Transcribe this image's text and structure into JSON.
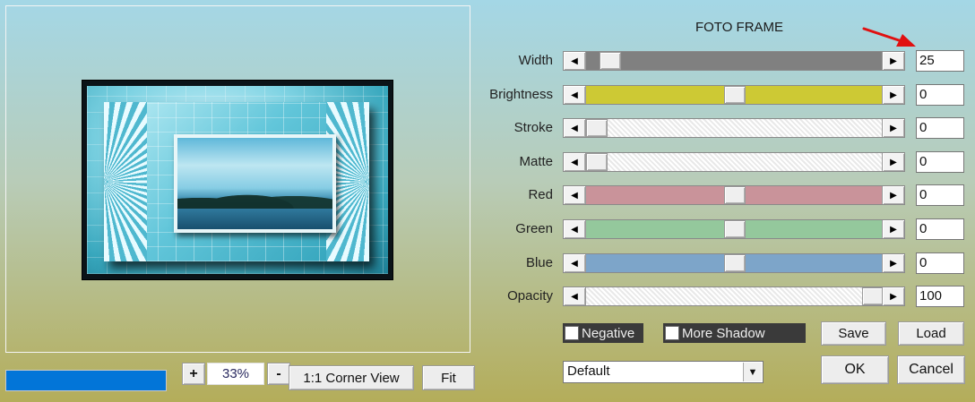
{
  "title": "FOTO FRAME",
  "sliders": [
    {
      "label": "Width",
      "value": "25",
      "position": 0.05,
      "fill": "#808080",
      "track_style": "solid"
    },
    {
      "label": "Brightness",
      "value": "0",
      "position": 0.5,
      "fill": "#cdc934",
      "track_style": "solid"
    },
    {
      "label": "Stroke",
      "value": "0",
      "position": 0.0,
      "fill": "#f4f4f4",
      "track_style": "hatched"
    },
    {
      "label": "Matte",
      "value": "0",
      "position": 0.0,
      "fill": "#f4f4f4",
      "track_style": "hatched"
    },
    {
      "label": "Red",
      "value": "0",
      "position": 0.5,
      "fill": "#c9939a",
      "track_style": "solid"
    },
    {
      "label": "Green",
      "value": "0",
      "position": 0.5,
      "fill": "#94c89c",
      "track_style": "solid"
    },
    {
      "label": "Blue",
      "value": "0",
      "position": 0.5,
      "fill": "#7da5c9",
      "track_style": "solid"
    },
    {
      "label": "Opacity",
      "value": "100",
      "position": 1.0,
      "fill": "#f4f4f4",
      "track_style": "hatched"
    }
  ],
  "checkboxes": {
    "negative": {
      "label": "Negative",
      "checked": false
    },
    "more_shadow": {
      "label": "More Shadow",
      "checked": false
    }
  },
  "buttons": {
    "save": "Save",
    "load": "Load",
    "ok": "OK",
    "cancel": "Cancel",
    "zoom_in": "+",
    "zoom_out": "-",
    "corner_view": "1:1 Corner View",
    "fit": "Fit"
  },
  "zoom": {
    "value": "33%"
  },
  "preset": {
    "selected": "Default"
  },
  "progress": {
    "fraction": 1.0,
    "color": "#0275d8"
  },
  "icons": {
    "arrow_left": "◀",
    "arrow_right": "▶",
    "dropdown": "▼"
  }
}
